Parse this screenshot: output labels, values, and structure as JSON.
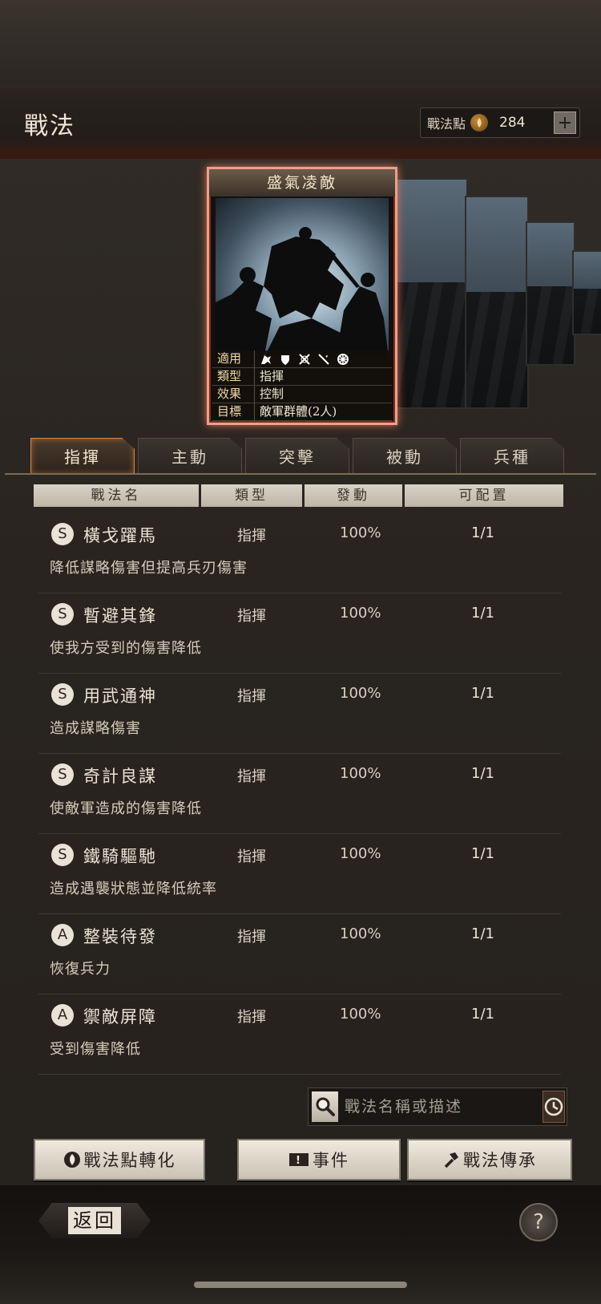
{
  "header": {
    "title": "戰法",
    "points_label": "戰法點",
    "points_value": "284",
    "add_label": "+"
  },
  "card": {
    "name": "盛氣凌敵",
    "rows": [
      {
        "key": "適用",
        "value": ""
      },
      {
        "key": "類型",
        "value": "指揮"
      },
      {
        "key": "效果",
        "value": "控制"
      },
      {
        "key": "目標",
        "value": "敵軍群體(2人)"
      }
    ],
    "applicable_icons": [
      "cavalry-icon",
      "shield-icon",
      "bow-icon",
      "spear-icon",
      "wheel-icon"
    ]
  },
  "tabs": [
    {
      "label": "指揮",
      "active": true
    },
    {
      "label": "主動",
      "active": false
    },
    {
      "label": "突擊",
      "active": false
    },
    {
      "label": "被動",
      "active": false
    },
    {
      "label": "兵種",
      "active": false
    }
  ],
  "table": {
    "headers": [
      "戰法名",
      "類型",
      "發動",
      "可配置"
    ],
    "rows": [
      {
        "grade": "S",
        "name": "橫戈躍馬",
        "type": "指揮",
        "rate": "100%",
        "slots": "1/1",
        "desc": "降低謀略傷害但提高兵刃傷害"
      },
      {
        "grade": "S",
        "name": "暫避其鋒",
        "type": "指揮",
        "rate": "100%",
        "slots": "1/1",
        "desc": "使我方受到的傷害降低"
      },
      {
        "grade": "S",
        "name": "用武通神",
        "type": "指揮",
        "rate": "100%",
        "slots": "1/1",
        "desc": "造成謀略傷害"
      },
      {
        "grade": "S",
        "name": "奇計良謀",
        "type": "指揮",
        "rate": "100%",
        "slots": "1/1",
        "desc": "使敵軍造成的傷害降低"
      },
      {
        "grade": "S",
        "name": "鐵騎驅馳",
        "type": "指揮",
        "rate": "100%",
        "slots": "1/1",
        "desc": "造成遇襲狀態並降低統率"
      },
      {
        "grade": "A",
        "name": "整裝待發",
        "type": "指揮",
        "rate": "100%",
        "slots": "1/1",
        "desc": "恢復兵力"
      },
      {
        "grade": "A",
        "name": "禦敵屏障",
        "type": "指揮",
        "rate": "100%",
        "slots": "1/1",
        "desc": "受到傷害降低"
      }
    ]
  },
  "search": {
    "placeholder": "戰法名稱或描述"
  },
  "buttons": {
    "convert": "戰法點轉化",
    "event": "事件",
    "inherit": "戰法傳承"
  },
  "footer": {
    "back": "返回",
    "help": "?"
  },
  "colors": {
    "accent": "#d58a4a",
    "card_border": "#e9a08e",
    "background": "#26221e"
  }
}
